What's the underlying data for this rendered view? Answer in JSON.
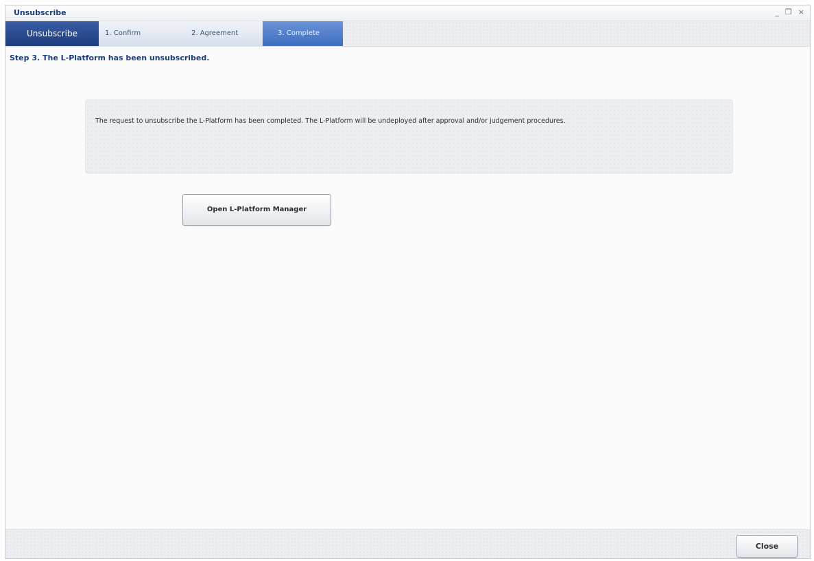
{
  "window": {
    "title": "Unsubscribe",
    "controls": {
      "minimize": "_",
      "restore": "❐",
      "close": "×"
    }
  },
  "wizard": {
    "name": "Unsubscribe",
    "steps": [
      {
        "label": "1. Confirm",
        "state": "done"
      },
      {
        "label": "2. Agreement",
        "state": "done"
      },
      {
        "label": "3. Complete",
        "state": "active"
      }
    ]
  },
  "main": {
    "heading": "Step 3. The L-Platform has been unsubscribed.",
    "message": "The request to unsubscribe the L-Platform has been completed. The L-Platform will be undeployed after approval and/or judgement procedures.",
    "open_button_label": "Open L-Platform Manager"
  },
  "footer": {
    "close_label": "Close"
  },
  "colors": {
    "title_blue": "#1c3c7a",
    "wizard_name_bg": "#1e3d7e",
    "active_step_bg": "#3e6ec1"
  }
}
